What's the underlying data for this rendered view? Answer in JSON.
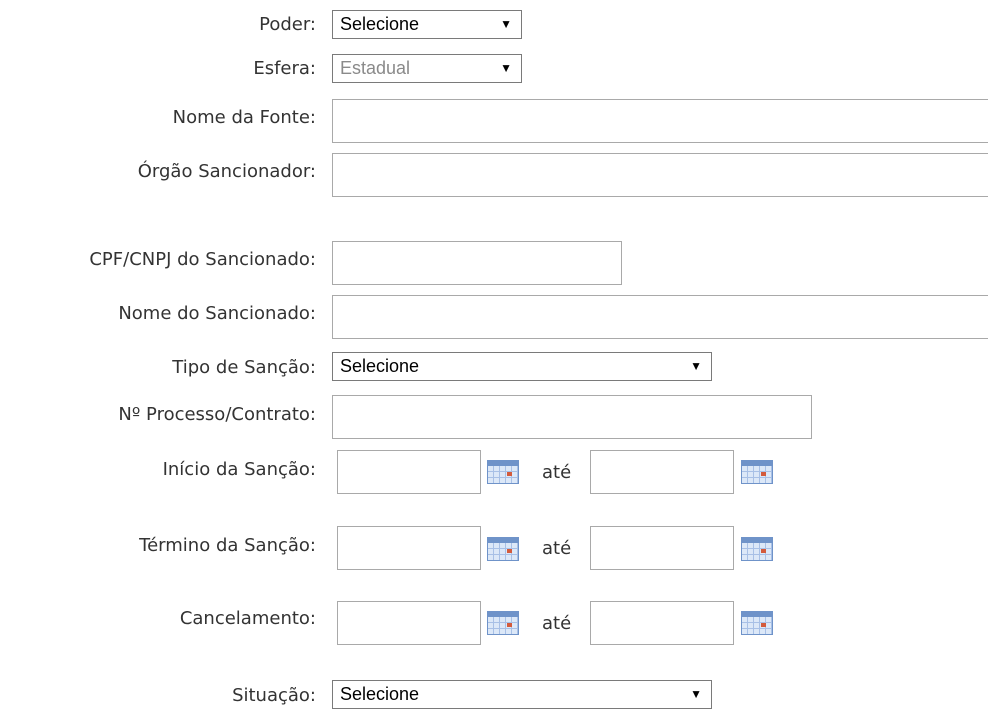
{
  "form": {
    "poder": {
      "label": "Poder:",
      "value": "Selecione"
    },
    "esfera": {
      "label": "Esfera:",
      "value": "Estadual"
    },
    "nome_fonte": {
      "label": "Nome da Fonte:",
      "value": ""
    },
    "orgao": {
      "label": "Órgão Sancionador:",
      "value": ""
    },
    "cpf_cnpj": {
      "label": "CPF/CNPJ do Sancionado:",
      "value": ""
    },
    "nome_sancionado": {
      "label": "Nome do Sancionado:",
      "value": ""
    },
    "tipo_sancao": {
      "label": "Tipo de Sanção:",
      "value": "Selecione"
    },
    "processo": {
      "label": "Nº Processo/Contrato:",
      "value": ""
    },
    "inicio": {
      "label": "Início da Sanção:"
    },
    "termino": {
      "label": "Término da Sanção:"
    },
    "cancelamento": {
      "label": "Cancelamento:"
    },
    "situacao": {
      "label": "Situação:",
      "value": "Selecione"
    },
    "range_sep": "até",
    "dropdown_arrow": "▼"
  }
}
